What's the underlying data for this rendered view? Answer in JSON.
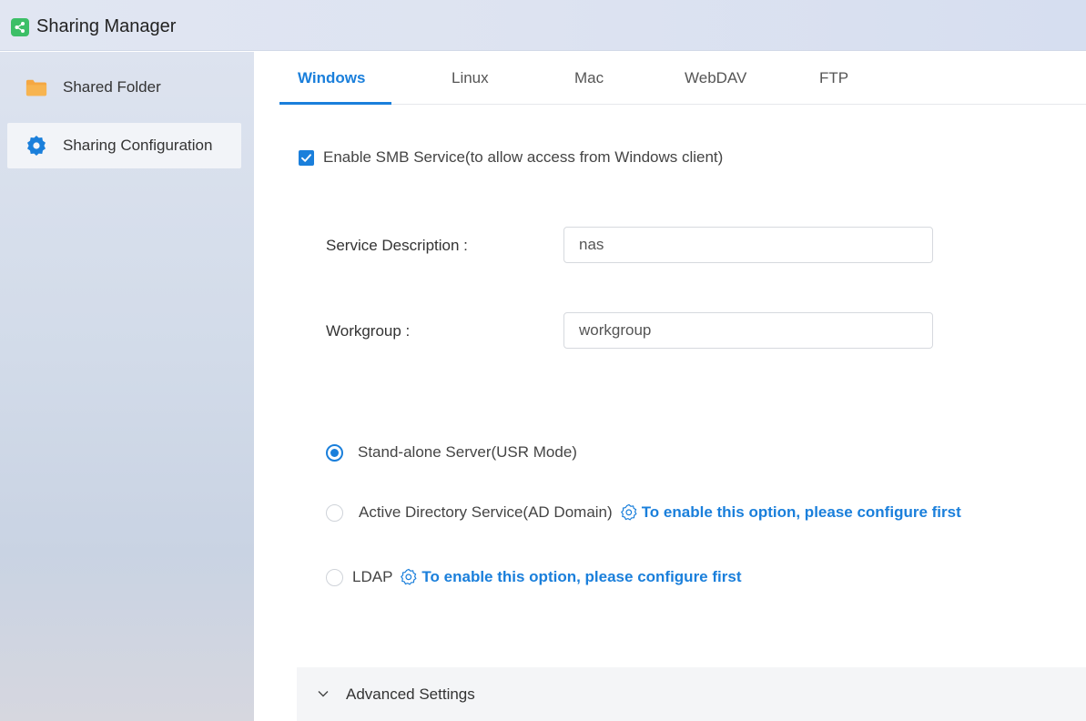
{
  "window": {
    "title": "Sharing Manager",
    "app_icon": "share-app-icon"
  },
  "sidebar": {
    "items": [
      {
        "label": "Shared Folder",
        "icon": "folder-icon",
        "active": false
      },
      {
        "label": "Sharing Configuration",
        "icon": "gear-icon",
        "active": true
      }
    ]
  },
  "tabs": [
    {
      "label": "Windows",
      "active": true
    },
    {
      "label": "Linux",
      "active": false
    },
    {
      "label": "Mac",
      "active": false
    },
    {
      "label": "WebDAV",
      "active": false
    },
    {
      "label": "FTP",
      "active": false
    }
  ],
  "smb": {
    "enabled": true,
    "label": "Enable SMB Service(to allow access from Windows client)"
  },
  "fields": {
    "service_description": {
      "label": "Service Description :",
      "value": "nas"
    },
    "workgroup": {
      "label": "Workgroup :",
      "value": "workgroup"
    }
  },
  "modes": [
    {
      "label": "Stand-alone Server(USR Mode)",
      "checked": true,
      "link": null
    },
    {
      "label": "Active Directory Service(AD Domain)",
      "checked": false,
      "link": "To enable this option, please configure first"
    },
    {
      "label": "LDAP",
      "checked": false,
      "link": "To enable this option, please configure first"
    }
  ],
  "advanced": {
    "label": "Advanced Settings",
    "expanded": false
  },
  "colors": {
    "accent": "#1a7fdb",
    "app_icon": "#3cbf67",
    "folder": "#f5a742",
    "sidebar_gear": "#1a7fdb"
  }
}
